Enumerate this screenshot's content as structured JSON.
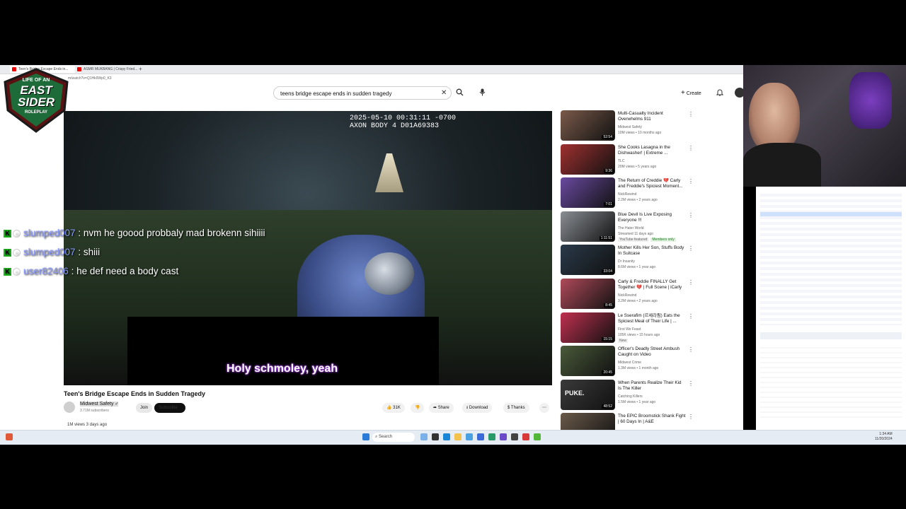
{
  "overlay": {
    "logo_line1": "LIFE OF AN",
    "logo_line2": "EAST",
    "logo_line3": "SIDER",
    "logo_line4": "ROLEPLAY"
  },
  "browser": {
    "tabs": [
      {
        "label": "Teen's Bridge Escape Ends in..."
      },
      {
        "label": "ASMR MUKBANG | Crispy Fried..."
      }
    ],
    "url": "m/watch?v=Q1Hk9Wp0_K3"
  },
  "yt_header": {
    "search_value": "teens bridge escape ends in sudden tragedy",
    "create_label": "Create"
  },
  "video": {
    "camstamp_line1": "2025-05-10 00:31:11 -0700",
    "camstamp_line2": "AXON BODY 4 D01A69383",
    "subtitle": "Holy schmoley, yeah",
    "title": "Teen's Bridge Escape Ends in Sudden Tragedy",
    "channel": "Midwest Safety",
    "subscribers": "3.71M subscribers",
    "join_label": "Join",
    "subscribe_label": "Subscribe",
    "likes": "31K",
    "share_label": "Share",
    "download_label": "Download",
    "thanks_label": "Thanks",
    "stats": "1M views  3 days ago"
  },
  "chat": [
    {
      "user": "slumped007",
      "message": ": nvm he goood probbaly mad brokenn sihiiii"
    },
    {
      "user": "slumped007",
      "message": ": shiii"
    },
    {
      "user": "user82406",
      "message": ": he def need a body cast"
    }
  ],
  "recommendations": [
    {
      "title": "Multi-Casualty Incident Overwhelms 911",
      "channel": "Midwest Safety",
      "meta": "10M views • 10 months ago",
      "duration": "52:54",
      "thumb_color": "#7a5a4a"
    },
    {
      "title": "She Cooks Lasagna in the Dishwasher! | Extreme ...",
      "channel": "TLC",
      "meta": "20M views • 5 years ago",
      "duration": "9:36",
      "thumb_color": "#a03030"
    },
    {
      "title": "The Return of Creddie 💔 Carly and Freddie's Spiciest Moment...",
      "channel": "NickRewind",
      "meta": "2.2M views • 2 years ago",
      "duration": "7:01",
      "thumb_color": "#6a4aa0"
    },
    {
      "title": "Blue Devil Is Live Exposing Everyone !!!",
      "channel": "The Hater World",
      "meta": "Streamed 11 days ago",
      "badge1": "YouTube featured",
      "badge2": "Members only",
      "duration": "1:11:51",
      "thumb_color": "#8a8f94"
    },
    {
      "title": "Mother Kills Her Son, Stuffs Body In Suitcase",
      "channel": "Dr Insanity",
      "meta": "8.6M views • 1 year ago",
      "duration": "33:04",
      "thumb_color": "#2a3a4a"
    },
    {
      "title": "Carly & Freddie FINALLY Get Together 💔 | Full Scene | iCarly",
      "channel": "NickRewind",
      "meta": "3.2M views • 2 years ago",
      "duration": "8:45",
      "thumb_color": "#b04a5a"
    },
    {
      "title": "Le Sserafim (르세라핌) Eats the Spiciest Meal of Their Life | ...",
      "channel": "First We Feast",
      "meta": "105K views • 15 hours ago",
      "badge1": "New",
      "duration": "15:15",
      "thumb_color": "#c03050"
    },
    {
      "title": "Officer's Deadly Street Ambush Caught on Video",
      "channel": "Midwest Crime",
      "meta": "1.3M views • 1 month ago",
      "duration": "20:45",
      "thumb_color": "#4a5a3a"
    },
    {
      "title": "When Parents Realize Their Kid Is The Killer",
      "channel": "Catching Killers",
      "meta": "1.5M views • 1 year ago",
      "duration": "48:52",
      "thumb_label": "PUKE.",
      "thumb_color": "#3a3a3a"
    },
    {
      "title": "The EPIC Broomstick Shank Fight | 60 Days In | A&E",
      "channel": "",
      "meta": "",
      "duration": "",
      "thumb_color": "#6a5a4a"
    }
  ],
  "taskbar": {
    "search_label": "Search",
    "time": "1:34 AM",
    "date": "11/20/2024"
  }
}
